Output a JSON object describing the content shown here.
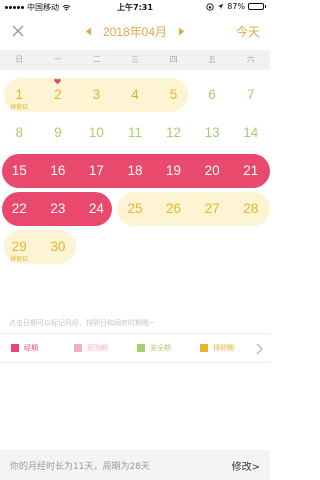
{
  "status_bar": {
    "carrier": "中国移动",
    "time": "上午7:31",
    "battery": "87%",
    "battery_level": 0.87
  },
  "nav": {
    "month_title": "2018年04月",
    "today_label": "今天"
  },
  "weekdays": [
    "日",
    "一",
    "二",
    "三",
    "四",
    "五",
    "六"
  ],
  "calendar": {
    "days": [
      {
        "d": "1",
        "type": "ovu",
        "sub": "排卵日"
      },
      {
        "d": "2",
        "type": "ovu",
        "heart": true
      },
      {
        "d": "3",
        "type": "ovu"
      },
      {
        "d": "4",
        "type": "ovu"
      },
      {
        "d": "5",
        "type": "ovu"
      },
      {
        "d": "6",
        "type": "safe"
      },
      {
        "d": "7",
        "type": "safe"
      },
      {
        "d": "8",
        "type": "safe"
      },
      {
        "d": "9",
        "type": "safe"
      },
      {
        "d": "10",
        "type": "safe"
      },
      {
        "d": "11",
        "type": "safe"
      },
      {
        "d": "12",
        "type": "safe"
      },
      {
        "d": "13",
        "type": "safe"
      },
      {
        "d": "14",
        "type": "safe"
      },
      {
        "d": "15",
        "type": "period"
      },
      {
        "d": "16",
        "type": "period"
      },
      {
        "d": "17",
        "type": "period"
      },
      {
        "d": "18",
        "type": "period"
      },
      {
        "d": "19",
        "type": "period"
      },
      {
        "d": "20",
        "type": "period"
      },
      {
        "d": "21",
        "type": "period"
      },
      {
        "d": "22",
        "type": "period"
      },
      {
        "d": "23",
        "type": "period"
      },
      {
        "d": "24",
        "type": "period"
      },
      {
        "d": "25",
        "type": "ovu"
      },
      {
        "d": "26",
        "type": "ovu"
      },
      {
        "d": "27",
        "type": "ovu"
      },
      {
        "d": "28",
        "type": "ovu"
      },
      {
        "d": "29",
        "type": "ovu",
        "sub": "排卵日"
      },
      {
        "d": "30",
        "type": "ovu"
      }
    ]
  },
  "hint_text": "点击日期可以标记月经、排卵日和同房时期哦~",
  "legend": [
    {
      "label": "经期",
      "color": "#e9496c"
    },
    {
      "label": "预测期",
      "color": "#f7aec3"
    },
    {
      "label": "安全期",
      "color": "#a6d06f"
    },
    {
      "label": "排卵期",
      "color": "#e8b32e"
    }
  ],
  "footer": {
    "summary": "你的月经时长为11天，周期为28天",
    "edit_label": "修改>"
  }
}
